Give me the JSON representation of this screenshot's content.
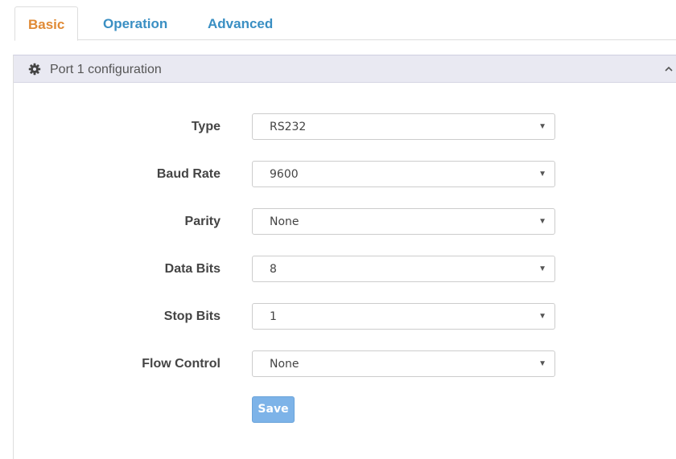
{
  "tabs": [
    {
      "label": "Basic",
      "active": true
    },
    {
      "label": "Operation",
      "active": false
    },
    {
      "label": "Advanced",
      "active": false
    }
  ],
  "panel": {
    "title": "Port 1 configuration",
    "icon": "gear-icon",
    "collapse_icon": "chevron-up-icon"
  },
  "fields": [
    {
      "label": "Type",
      "value": "RS232"
    },
    {
      "label": "Baud Rate",
      "value": "9600"
    },
    {
      "label": "Parity",
      "value": "None"
    },
    {
      "label": "Data Bits",
      "value": "8"
    },
    {
      "label": "Stop Bits",
      "value": "1"
    },
    {
      "label": "Flow Control",
      "value": "None"
    }
  ],
  "save_label": "Save",
  "colors": {
    "active_tab": "#e08a35",
    "inactive_tab": "#3a8fc3",
    "panel_heading_bg": "#e9e9f2",
    "save_button": "#7db3e8"
  }
}
